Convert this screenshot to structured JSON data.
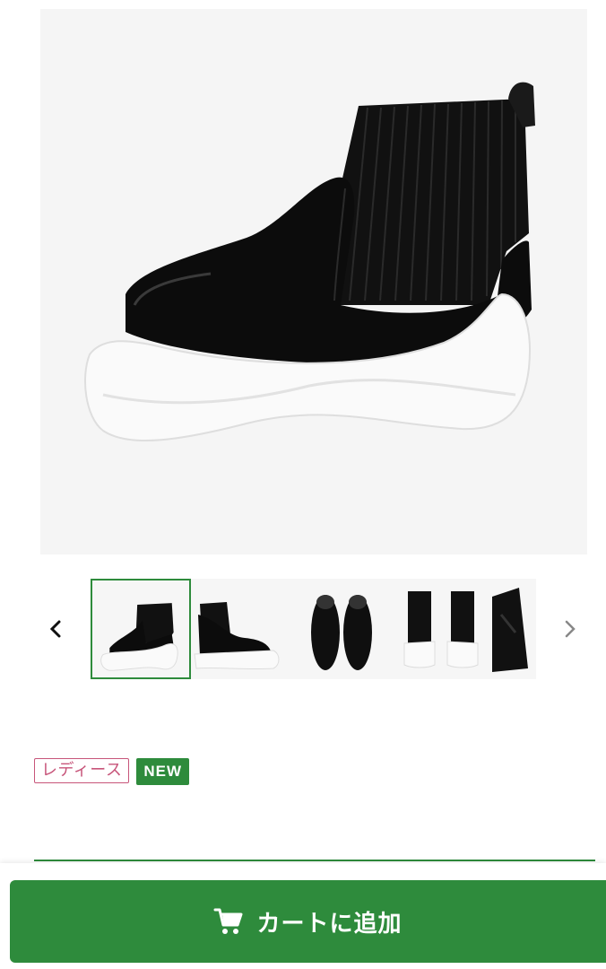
{
  "product": {
    "main_image_alt": "product-boot-main",
    "thumbnails": [
      {
        "name": "thumb-side-view",
        "active": true
      },
      {
        "name": "thumb-side-view-alt",
        "active": false
      },
      {
        "name": "thumb-top-view",
        "active": false
      },
      {
        "name": "thumb-back-view",
        "active": false
      },
      {
        "name": "thumb-detail-view",
        "active": false
      }
    ]
  },
  "tags": {
    "category": "レディース",
    "new": "NEW"
  },
  "cart": {
    "label": "カートに追加",
    "icon": "cart-icon"
  },
  "colors": {
    "accent": "#2e8b3c",
    "ladies_tag": "#c7557a"
  }
}
